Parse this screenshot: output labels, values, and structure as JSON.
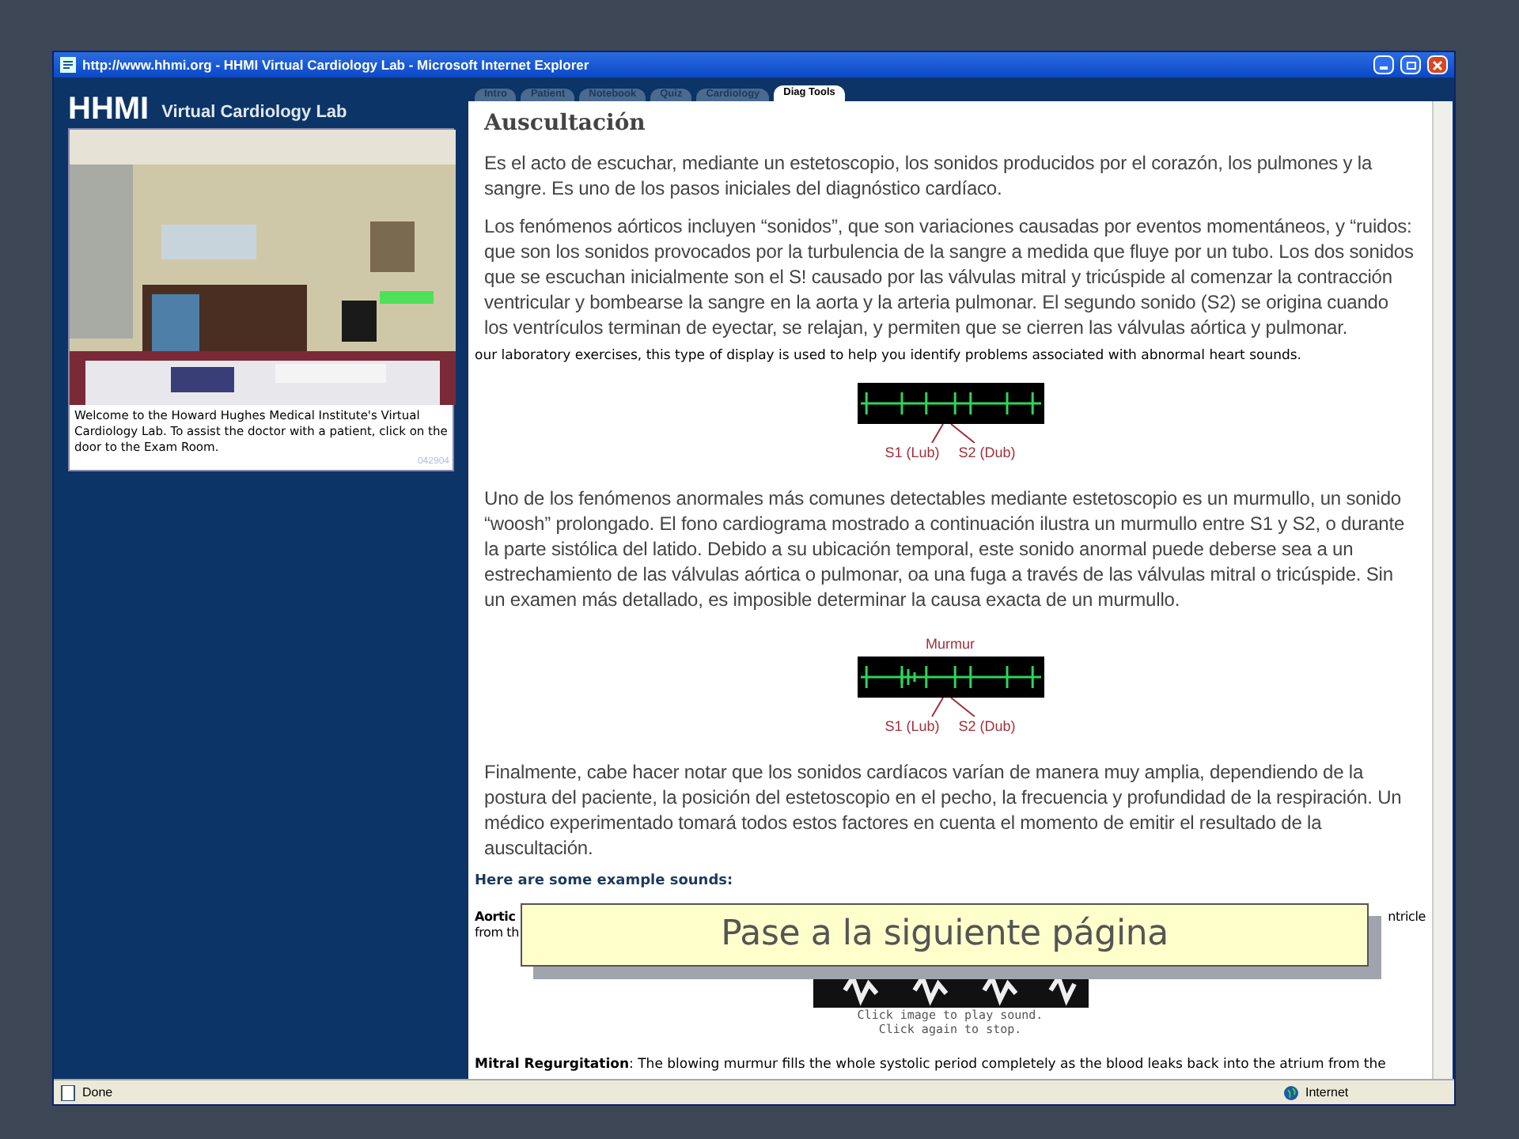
{
  "window": {
    "title": "http://www.hhmi.org - HHMI Virtual Cardiology Lab - Microsoft Internet Explorer"
  },
  "tabs": [
    {
      "label": "Intro",
      "selected": false
    },
    {
      "label": "Patient",
      "selected": false
    },
    {
      "label": "Notebook",
      "selected": false
    },
    {
      "label": "Quiz",
      "selected": false
    },
    {
      "label": "Cardiology",
      "selected": false
    },
    {
      "label": "Diag Tools",
      "selected": true
    }
  ],
  "sidebar": {
    "logo": "HHMI",
    "logo_subtitle": "Virtual Cardiology Lab",
    "caption": "Welcome to the Howard Hughes Medical Institute's Virtual Cardiology Lab.  To assist the doctor with a patient, click on the door to the Exam Room.",
    "code": "042904"
  },
  "page": {
    "heading": "Auscultación",
    "content": [
      {
        "kind": "paragraph",
        "text": "Es el acto de escuchar, mediante un estetoscopio, los sonidos producidos por el corazón, los pulmones y la sangre.  Es uno de los pasos iniciales del diagnóstico cardíaco."
      },
      {
        "kind": "paragraph",
        "text": "Los fenómenos aórticos incluyen “sonidos”,  que son variaciones causadas por eventos momentáneos, y “ruidos: que son los sonidos provocados por la turbulencia de la sangre a medida que fluye por un tubo.  Los dos sonidos que se escuchan inicialmente son el S! causado por las válvulas mitral y tricúspide al comenzar la contracción ventricular y bombearse la sangre en la aorta y la arteria pulmonar. El segundo sonido (S2) se origina cuando los ventrículos terminan de eyectar, se relajan, y permiten que se cierren las válvulas aórtica y pulmonar."
      },
      {
        "kind": "note",
        "text": "our laboratory exercises, this type of display is used to help you identify problems associated with abnormal heart sounds."
      },
      {
        "kind": "figure",
        "labels": [
          "S1 (Lub)",
          "S2 (Dub)"
        ]
      },
      {
        "kind": "paragraph",
        "text": "Uno de los fenómenos anormales más comunes detectables mediante estetoscopio es un murmullo, un sonido “woosh” prolongado.  El fono cardiograma mostrado a continuación ilustra un murmullo entre S1 y S2, o durante la parte sistólica del latido.  Debido a su ubicación temporal,  este sonido anormal puede deberse sea a un estrechamiento de las válvulas aórtica o pulmonar, oa una fuga a través de las válvulas mitral o tricúspide.  Sin un examen más detallado, es imposible determinar la causa exacta de un murmullo."
      },
      {
        "kind": "figure",
        "top_label": "Murmur",
        "labels": [
          "S1 (Lub)",
          "S2 (Dub)"
        ]
      },
      {
        "kind": "paragraph",
        "text": "Finalmente, cabe hacer notar que los sonidos cardíacos varían de manera muy amplia, dependiendo de la postura del paciente, la posición del estetoscopio en el pecho, la frecuencia y profundidad de la respiración. Un médico experimentado tomará todos estos factores en cuenta el momento de emitir el resultado de la auscultación."
      },
      {
        "kind": "subheading",
        "text": "Here are some example sounds:"
      },
      {
        "kind": "partial",
        "left": [
          "Aortic",
          "from th"
        ],
        "right": "ntricle"
      },
      {
        "kind": "sound",
        "lines": [
          "Click image to play sound.",
          "Click again to stop."
        ]
      },
      {
        "kind": "entry",
        "term": "Mitral Regurgitation",
        "text": ": The blowing murmur fills the whole systolic period completely as the blood leaks back into the atrium from the"
      }
    ]
  },
  "overlay": {
    "text": "Pase a la siguiente página"
  },
  "status_bar": {
    "status": "Done",
    "zone": "Internet"
  }
}
